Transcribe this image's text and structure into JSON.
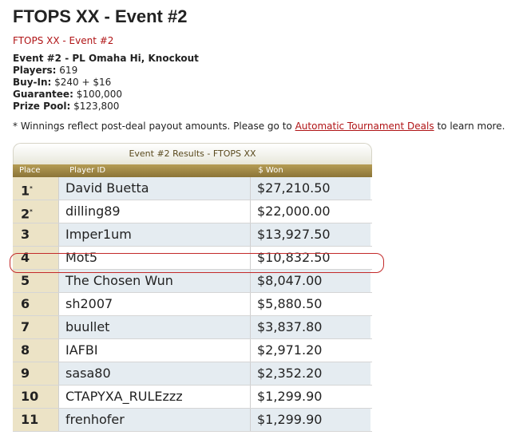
{
  "page": {
    "title": "FTOPS XX - Event #2",
    "breadcrumb": "FTOPS XX - Event #2"
  },
  "info": {
    "event_line": "Event #2 - PL Omaha Hi, Knockout",
    "players_label": "Players:",
    "players_value": "619",
    "buyin_label": "Buy-In:",
    "buyin_value": "$240 + $16",
    "guarantee_label": "Guarantee:",
    "guarantee_value": "$100,000",
    "prizepool_label": "Prize Pool:",
    "prizepool_value": "$123,800"
  },
  "note": {
    "prefix": "* Winnings reflect post-deal payout amounts. Please go to",
    "link": "Automatic Tournament Deals",
    "suffix": "to learn more."
  },
  "table": {
    "caption": "Event #2 Results - FTOPS XX",
    "headers": [
      "Place",
      "Player ID",
      "$ Won"
    ],
    "rows": [
      {
        "place": "1",
        "mark": "*",
        "player": "David Buetta",
        "won": "$27,210.50"
      },
      {
        "place": "2",
        "mark": "*",
        "player": "dilling89",
        "won": "$22,000.00"
      },
      {
        "place": "3",
        "mark": "",
        "player": "Imper1um",
        "won": "$13,927.50"
      },
      {
        "place": "4",
        "mark": "",
        "player": "Mot5",
        "won": "$10,832.50"
      },
      {
        "place": "5",
        "mark": "",
        "player": "The Chosen Wun",
        "won": "$8,047.00"
      },
      {
        "place": "6",
        "mark": "",
        "player": "sh2007",
        "won": "$5,880.50"
      },
      {
        "place": "7",
        "mark": "",
        "player": "buullet",
        "won": "$3,837.80"
      },
      {
        "place": "8",
        "mark": "",
        "player": "IAFBI",
        "won": "$2,971.20"
      },
      {
        "place": "9",
        "mark": "",
        "player": "sasa80",
        "won": "$2,352.20"
      },
      {
        "place": "10",
        "mark": "",
        "player": "CTAPYXA_RULEzzz",
        "won": "$1,299.90"
      },
      {
        "place": "11",
        "mark": "",
        "player": "frenhofer",
        "won": "$1,299.90"
      }
    ]
  },
  "colors": {
    "accent_red": "#b01416",
    "header_gold": "#9c8443",
    "place_bg": "#ece3c6",
    "alt_row": "#e5ecf1"
  }
}
